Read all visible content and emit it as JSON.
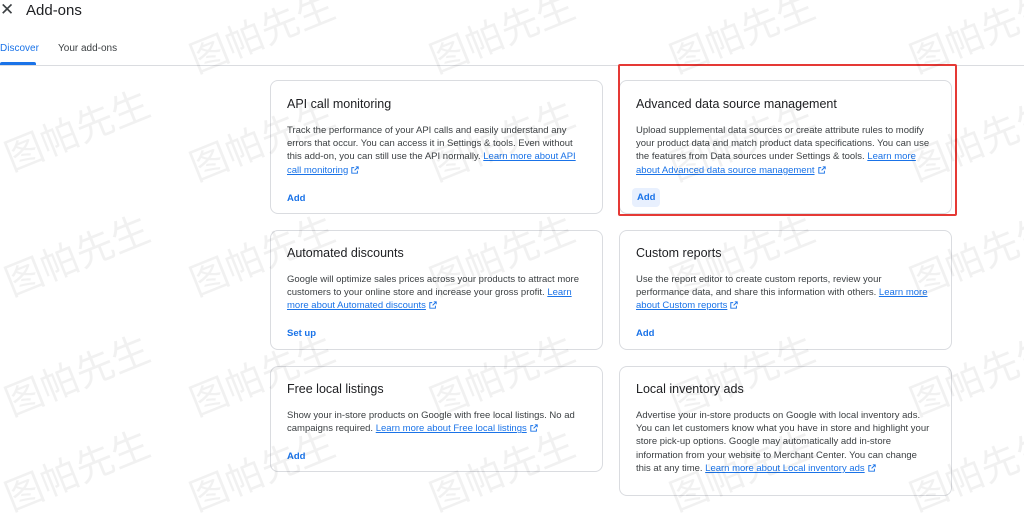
{
  "header": {
    "close_glyph": "✕",
    "title": "Add-ons"
  },
  "tabs": [
    {
      "label": "Discover",
      "active": true
    },
    {
      "label": "Your add-ons",
      "active": false
    }
  ],
  "cards": [
    {
      "title": "API call monitoring",
      "description": "Track the performance of your API calls and easily understand any errors that occur. You can access it in Settings & tools. Even without this add-on, you can still use the API normally.",
      "link": "Learn more about API call monitoring",
      "action": "Add"
    },
    {
      "title": "Advanced data source management",
      "description": "Upload supplemental data sources or create attribute rules to modify your product data and match product data specifications. You can use the features from Data sources under Settings & tools.",
      "link": "Learn more about Advanced data source management",
      "action": "Add"
    },
    {
      "title": "Automated discounts",
      "description": "Google will optimize sales prices across your products to attract more customers to your online store and increase your gross profit.",
      "link": "Learn more about Automated discounts",
      "action": "Set up"
    },
    {
      "title": "Custom reports",
      "description": "Use the report editor to create custom reports, review your performance data, and share this information with others.",
      "link": "Learn more about Custom reports",
      "action": "Add"
    },
    {
      "title": "Free local listings",
      "description": "Show your in-store products on Google with free local listings. No ad campaigns required.",
      "link": "Learn more about Free local listings",
      "action": "Add"
    },
    {
      "title": "Local inventory ads",
      "description": "Advertise your in-store products on Google with local inventory ads. You can let customers know what you have in store and highlight your store pick-up options. Google may automatically add in-store information from your website to Merchant Center. You can change this at any time.",
      "link": "Learn more about Local inventory ads",
      "action": ""
    }
  ],
  "watermark_text": "图帕先生",
  "colors": {
    "accent": "#1a73e8",
    "highlight": "#e53935",
    "border": "#dadce0"
  }
}
